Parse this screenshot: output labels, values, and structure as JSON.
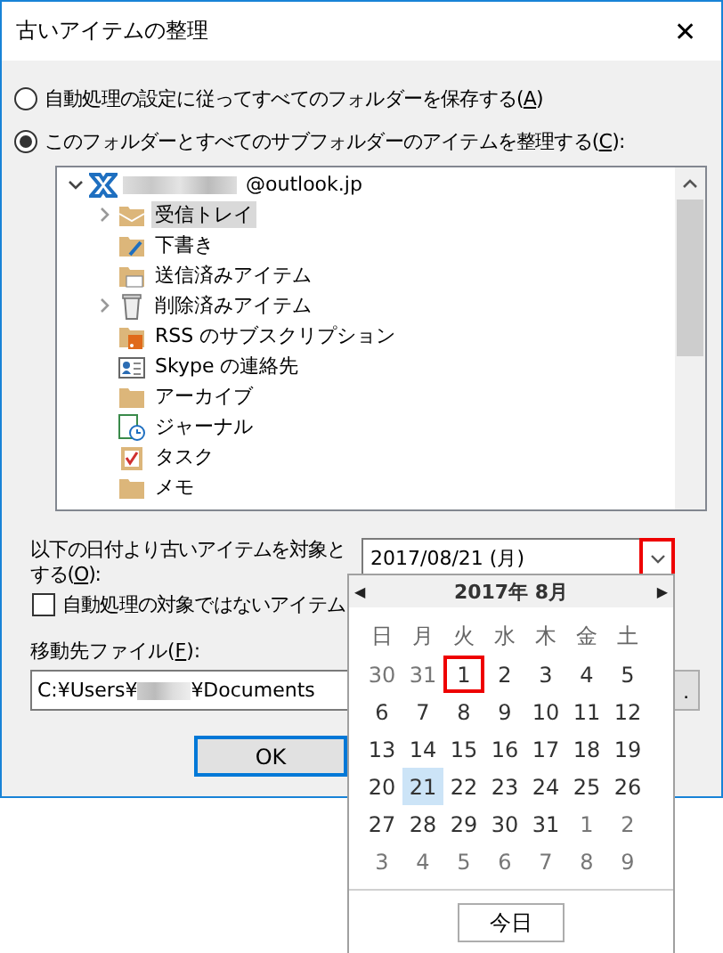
{
  "window": {
    "title": "古いアイテムの整理",
    "close": "✕"
  },
  "options": [
    {
      "label": "自動処理の設定に従ってすべてのフォルダーを保存する(",
      "key": "A",
      "label_end": ")",
      "selected": false
    },
    {
      "label": "このフォルダーとすべてのサブフォルダーのアイテムを整理する(",
      "key": "C",
      "label_end": "):",
      "selected": true
    }
  ],
  "tree": {
    "account": {
      "label": "@outlook.jp",
      "expanded": true,
      "children": [
        {
          "label": "受信トレイ",
          "kind": "inbox",
          "expanded": false,
          "selected": true
        },
        {
          "label": "下書き",
          "kind": "draft",
          "selected": false
        },
        {
          "label": "送信済みアイテム",
          "kind": "sent",
          "selected": false
        },
        {
          "label": "削除済みアイテム",
          "kind": "trash",
          "expanded": false,
          "selected": false
        },
        {
          "label": "RSS のサブスクリプション",
          "kind": "rss",
          "selected": false
        },
        {
          "label": "Skype の連絡先",
          "kind": "contacts",
          "selected": false
        },
        {
          "label": "アーカイブ",
          "kind": "folder",
          "selected": false
        },
        {
          "label": "ジャーナル",
          "kind": "journal",
          "selected": false
        },
        {
          "label": "タスク",
          "kind": "task",
          "selected": false
        },
        {
          "label": "メモ",
          "kind": "note",
          "selected": false
        }
      ]
    }
  },
  "date": {
    "label_1": "以下の日付より古いアイテムを対象と",
    "label_2": "する(",
    "key": "O",
    "label_end": "):",
    "value": "2017/08/21 (月)",
    "dropdown_highlighted": true
  },
  "checkbox": {
    "label": "自動処理の対象ではないアイテム",
    "checked": false
  },
  "file": {
    "label": "移動先ファイル(",
    "key": "F",
    "label_end": "):",
    "value_start": "C:¥Users¥",
    "value_end": "¥Documents",
    "browse": "."
  },
  "ok": "OK",
  "calendar": {
    "prev": "◀",
    "next": "▶",
    "month": "2017年 8月",
    "weekdays": [
      "日",
      "月",
      "火",
      "水",
      "木",
      "金",
      "土"
    ],
    "weeks": [
      [
        {
          "day": "30",
          "muted": true,
          "selected": false,
          "highlighted": false
        },
        {
          "day": "31",
          "muted": true,
          "selected": false,
          "highlighted": false
        },
        {
          "day": "1",
          "muted": false,
          "selected": false,
          "highlighted": true
        },
        {
          "day": "2",
          "muted": false,
          "selected": false,
          "highlighted": false
        },
        {
          "day": "3",
          "muted": false,
          "selected": false,
          "highlighted": false
        },
        {
          "day": "4",
          "muted": false,
          "selected": false,
          "highlighted": false
        },
        {
          "day": "5",
          "muted": false,
          "selected": false,
          "highlighted": false
        }
      ],
      [
        {
          "day": "6",
          "muted": false,
          "selected": false,
          "highlighted": false
        },
        {
          "day": "7",
          "muted": false,
          "selected": false,
          "highlighted": false
        },
        {
          "day": "8",
          "muted": false,
          "selected": false,
          "highlighted": false
        },
        {
          "day": "9",
          "muted": false,
          "selected": false,
          "highlighted": false
        },
        {
          "day": "10",
          "muted": false,
          "selected": false,
          "highlighted": false
        },
        {
          "day": "11",
          "muted": false,
          "selected": false,
          "highlighted": false
        },
        {
          "day": "12",
          "muted": false,
          "selected": false,
          "highlighted": false
        }
      ],
      [
        {
          "day": "13",
          "muted": false,
          "selected": false,
          "highlighted": false
        },
        {
          "day": "14",
          "muted": false,
          "selected": false,
          "highlighted": false
        },
        {
          "day": "15",
          "muted": false,
          "selected": false,
          "highlighted": false
        },
        {
          "day": "16",
          "muted": false,
          "selected": false,
          "highlighted": false
        },
        {
          "day": "17",
          "muted": false,
          "selected": false,
          "highlighted": false
        },
        {
          "day": "18",
          "muted": false,
          "selected": false,
          "highlighted": false
        },
        {
          "day": "19",
          "muted": false,
          "selected": false,
          "highlighted": false
        }
      ],
      [
        {
          "day": "20",
          "muted": false,
          "selected": false,
          "highlighted": false
        },
        {
          "day": "21",
          "muted": false,
          "selected": true,
          "highlighted": false
        },
        {
          "day": "22",
          "muted": false,
          "selected": false,
          "highlighted": false
        },
        {
          "day": "23",
          "muted": false,
          "selected": false,
          "highlighted": false
        },
        {
          "day": "24",
          "muted": false,
          "selected": false,
          "highlighted": false
        },
        {
          "day": "25",
          "muted": false,
          "selected": false,
          "highlighted": false
        },
        {
          "day": "26",
          "muted": false,
          "selected": false,
          "highlighted": false
        }
      ],
      [
        {
          "day": "27",
          "muted": false,
          "selected": false,
          "highlighted": false
        },
        {
          "day": "28",
          "muted": false,
          "selected": false,
          "highlighted": false
        },
        {
          "day": "29",
          "muted": false,
          "selected": false,
          "highlighted": false
        },
        {
          "day": "30",
          "muted": false,
          "selected": false,
          "highlighted": false
        },
        {
          "day": "31",
          "muted": false,
          "selected": false,
          "highlighted": false
        },
        {
          "day": "1",
          "muted": true,
          "selected": false,
          "highlighted": false
        },
        {
          "day": "2",
          "muted": true,
          "selected": false,
          "highlighted": false
        }
      ],
      [
        {
          "day": "3",
          "muted": true,
          "selected": false,
          "highlighted": false
        },
        {
          "day": "4",
          "muted": true,
          "selected": false,
          "highlighted": false
        },
        {
          "day": "5",
          "muted": true,
          "selected": false,
          "highlighted": false
        },
        {
          "day": "6",
          "muted": true,
          "selected": false,
          "highlighted": false
        },
        {
          "day": "7",
          "muted": true,
          "selected": false,
          "highlighted": false
        },
        {
          "day": "8",
          "muted": true,
          "selected": false,
          "highlighted": false
        },
        {
          "day": "9",
          "muted": true,
          "selected": false,
          "highlighted": false
        }
      ]
    ],
    "today": "今日"
  }
}
